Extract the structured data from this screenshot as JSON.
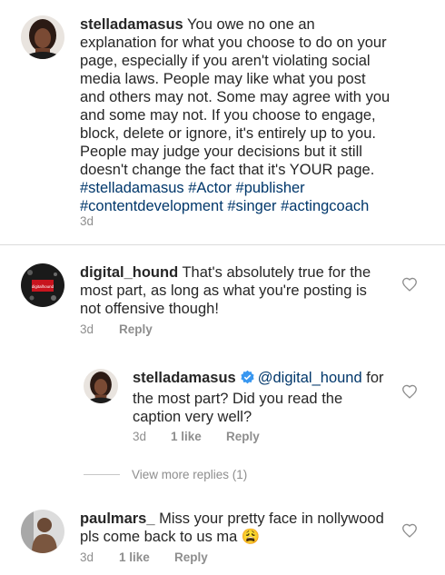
{
  "comments": [
    {
      "username": "stelladamasus",
      "text_main": "You owe no one an explanation for what you choose to do on your page, especially if you aren't violating social media laws. People may like what you post and others may not. Some may agree with you and some may not. If you choose to engage, block, delete or ignore, it's entirely up to you. People may judge your decisions but it still doesn't change the fact that it's YOUR page.",
      "hashtags": [
        "#stelladamasus",
        "#Actor",
        "#publisher",
        "#contentdevelopment",
        "#singer",
        "#actingcoach"
      ],
      "time": "3d"
    },
    {
      "username": "digital_hound",
      "text": "That's absolutely true for the most part, as long as what you're posting is not offensive though!",
      "time": "3d",
      "reply_label": "Reply",
      "avatar_text": "digitalhound"
    },
    {
      "username": "stelladamasus",
      "mention": "@digital_hound",
      "text": "for the most part? Did you read the caption very well?",
      "time": "3d",
      "likes": "1 like",
      "reply_label": "Reply"
    },
    {
      "username": "paulmars_",
      "text": "Miss your pretty face in nollywood pls come back to us ma 😩",
      "time": "3d",
      "likes": "1 like",
      "reply_label": "Reply"
    }
  ],
  "view_more_replies": "View more replies (1)",
  "icons": {
    "like": "heart-outline-icon",
    "verified": "verified-badge-icon"
  },
  "colors": {
    "hashtag": "#00376b",
    "verified": "#3897f0",
    "meta": "#8e8e8e"
  }
}
